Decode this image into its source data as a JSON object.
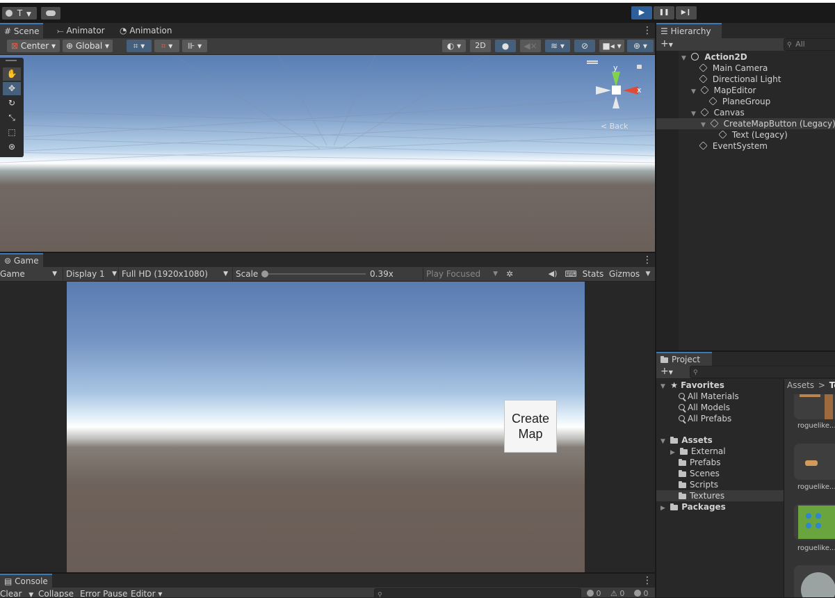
{
  "topbar": {
    "account_initial": "T",
    "account_icon": "account-icon",
    "cloud_icon": "cloud-icon",
    "play_icon": "▶",
    "pause_icon": "❚❚",
    "step_icon": "▶❙"
  },
  "scene": {
    "tabs": [
      {
        "icon": "#",
        "label": "Scene"
      },
      {
        "icon": "⤚",
        "label": "Animator"
      },
      {
        "icon": "◔",
        "label": "Animation"
      }
    ],
    "toolbar": {
      "pivot": "Center ▾",
      "space": "Global ▾",
      "mode_2d": "2D"
    },
    "gizmo": {
      "axis_y": "y",
      "axis_x": "x",
      "view_label": "< Back"
    }
  },
  "game": {
    "tab_label": "Game",
    "toolbar": {
      "mode": "Game",
      "display": "Display 1",
      "resolution": "Full HD (1920x1080)",
      "scale_label": "Scale",
      "scale_value": "0.39x",
      "play_focused": "Play Focused",
      "stats": "Stats",
      "gizmos": "Gizmos"
    },
    "button": {
      "line1": "Create",
      "line2": "Map"
    }
  },
  "console": {
    "tab_label": "Console",
    "clear": "Clear",
    "collapse": "Collapse",
    "error_pause": "Error Pause",
    "editor": "Editor ▾",
    "count_info": "0",
    "count_warn": "0",
    "count_error": "0"
  },
  "hierarchy": {
    "tab_label": "Hierarchy",
    "search_placeholder": "All",
    "items": [
      {
        "label": "Action2D",
        "depth": 0,
        "arrow": "▼",
        "scene": true
      },
      {
        "label": "Main Camera",
        "depth": 1,
        "arrow": ""
      },
      {
        "label": "Directional Light",
        "depth": 1,
        "arrow": ""
      },
      {
        "label": "MapEditor",
        "depth": 1,
        "arrow": "▼"
      },
      {
        "label": "PlaneGroup",
        "depth": 2,
        "arrow": ""
      },
      {
        "label": "Canvas",
        "depth": 1,
        "arrow": "▼"
      },
      {
        "label": "CreateMapButton (Legacy)",
        "depth": 2,
        "arrow": "▼",
        "selected": true
      },
      {
        "label": "Text (Legacy)",
        "depth": 3,
        "arrow": ""
      },
      {
        "label": "EventSystem",
        "depth": 1,
        "arrow": ""
      }
    ]
  },
  "project": {
    "tab_label": "Project",
    "breadcrumb": {
      "root": "Assets",
      "sep": ">",
      "current": "Te"
    },
    "favorites": {
      "label": "Favorites",
      "items": [
        "All Materials",
        "All Models",
        "All Prefabs"
      ]
    },
    "assets": {
      "label": "Assets",
      "items": [
        {
          "label": "External",
          "arrow": "▶"
        },
        {
          "label": "Prefabs",
          "arrow": ""
        },
        {
          "label": "Scenes",
          "arrow": ""
        },
        {
          "label": "Scripts",
          "arrow": ""
        },
        {
          "label": "Textures",
          "arrow": "",
          "selected": true
        }
      ]
    },
    "packages": {
      "label": "Packages"
    },
    "thumbnails": [
      "roguelike...",
      "roguelike...",
      "roguelike..."
    ]
  }
}
